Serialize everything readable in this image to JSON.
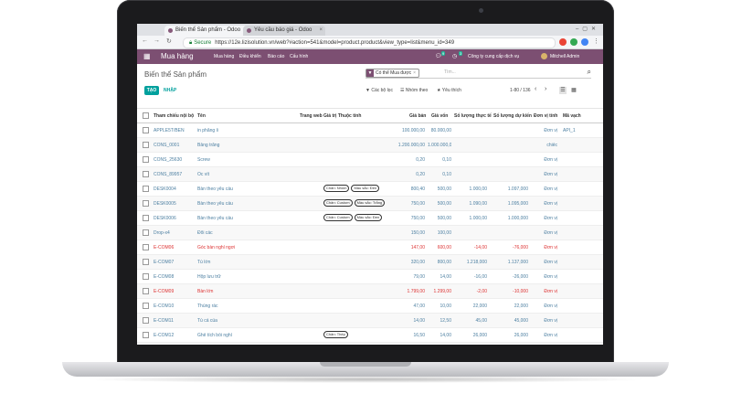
{
  "browser": {
    "tabs": [
      {
        "title": "Biến thể Sản phẩm - Odoo"
      },
      {
        "title": "Yêu cầu báo giá - Odoo"
      }
    ],
    "secure_label": "Secure",
    "url": "https://12e.lizisolution.vn/web?#action=541&model=product.product&view_type=list&menu_id=349"
  },
  "odoo_nav": {
    "brand": "Mua hàng",
    "menus": [
      "Mua hàng",
      "Điều khiển",
      "Báo cáo",
      "Cấu hình"
    ],
    "company": "Công ty cung cấp dịch vụ",
    "user": "Mitchell Admin",
    "badges": [
      "9",
      "3"
    ]
  },
  "control_panel": {
    "breadcrumb": "Biến thể Sản phẩm",
    "facet_label": "Có thể Mua được",
    "search_placeholder": "Tìm...",
    "create_label": "TẠO",
    "import_label": "NHẬP",
    "filters_label": "Các bộ lọc",
    "groupby_label": "Nhóm theo",
    "favorites_label": "Yêu thích",
    "pager": "1-80 / 136"
  },
  "table": {
    "headers": [
      "Tham chiếu nội bộ",
      "Tên",
      "Trang web",
      "Giá trị Thuộc tính",
      "Giá bán",
      "Giá vốn",
      "Số lượng thực tế",
      "Số lượng dự kiến",
      "Đơn vị tính",
      "Mã vạch"
    ],
    "rows": [
      {
        "ref": "APPLE5T/BEN",
        "name": "in phẳng ỉi",
        "attrs": [],
        "price": "100.000,00",
        "cost": "80.000,00",
        "qty": "",
        "forecast": "",
        "uom": "Đơn vị",
        "barcode": "API_1",
        "red": false
      },
      {
        "ref": "CONS_0001",
        "name": "Bảng trắng",
        "attrs": [],
        "price": "1.200.000,00",
        "cost": "1.000.000,00",
        "qty": "",
        "forecast": "",
        "uom": "chiếc",
        "barcode": "",
        "red": false
      },
      {
        "ref": "CONS_25630",
        "name": "Screw",
        "attrs": [],
        "price": "0,20",
        "cost": "0,10",
        "qty": "",
        "forecast": "",
        "uom": "Đơn vị",
        "barcode": "",
        "red": false
      },
      {
        "ref": "CONS_89957",
        "name": "Ốc vít",
        "attrs": [],
        "price": "0,20",
        "cost": "0,10",
        "qty": "",
        "forecast": "",
        "uom": "Đơn vị",
        "barcode": "",
        "red": false
      },
      {
        "ref": "DESK0004",
        "name": "Bàn theo yêu cầu",
        "attrs": [
          "Chân: Nhôm",
          "Màu sắc: Đen"
        ],
        "price": "800,40",
        "cost": "500,00",
        "qty": "1.000,00",
        "forecast": "1.097,000",
        "uom": "Đơn vị",
        "barcode": "",
        "red": false
      },
      {
        "ref": "DESK0005",
        "name": "Bàn theo yêu cầu",
        "attrs": [
          "Chân: Custom",
          "Màu sắc: Trắng"
        ],
        "price": "750,00",
        "cost": "500,00",
        "qty": "1.090,00",
        "forecast": "1.095,000",
        "uom": "Đơn vị",
        "barcode": "",
        "red": false
      },
      {
        "ref": "DESK0006",
        "name": "Bàn theo yêu cầu",
        "attrs": [
          "Chân: Custom",
          "Màu sắc: Đen"
        ],
        "price": "750,00",
        "cost": "500,00",
        "qty": "1.000,00",
        "forecast": "1.000,000",
        "uom": "Đơn vị",
        "barcode": "",
        "red": false
      },
      {
        "ref": "Drop-x4",
        "name": "Đổi các",
        "attrs": [],
        "price": "150,00",
        "cost": "100,00",
        "qty": "",
        "forecast": "",
        "uom": "Đơn vị",
        "barcode": "",
        "red": false
      },
      {
        "ref": "E-COM06",
        "name": "Góc bàn nghỉ ngơi",
        "attrs": [],
        "price": "147,00",
        "cost": "600,00",
        "qty": "-14,00",
        "forecast": "-76,000",
        "uom": "Đơn vị",
        "barcode": "",
        "red": true
      },
      {
        "ref": "E-COM07",
        "name": "Tủ lớn",
        "attrs": [],
        "price": "320,00",
        "cost": "800,00",
        "qty": "1.218,000",
        "forecast": "1.137,000",
        "uom": "Đơn vị",
        "barcode": "",
        "red": false
      },
      {
        "ref": "E-COM08",
        "name": "Hộp lưu trữ",
        "attrs": [],
        "price": "79,00",
        "cost": "14,00",
        "qty": "-16,00",
        "forecast": "-26,000",
        "uom": "Đơn vị",
        "barcode": "",
        "red": false
      },
      {
        "ref": "E-COM09",
        "name": "Bàn lớn",
        "attrs": [],
        "price": "1.799,00",
        "cost": "1.299,00",
        "qty": "-2,00",
        "forecast": "-10,000",
        "uom": "Đơn vị",
        "barcode": "",
        "red": true
      },
      {
        "ref": "E-COM10",
        "name": "Thùng rác",
        "attrs": [],
        "price": "47,00",
        "cost": "10,00",
        "qty": "22,000",
        "forecast": "22,000",
        "uom": "Đơn vị",
        "barcode": "",
        "red": false
      },
      {
        "ref": "E-COM11",
        "name": "Tủ cá của",
        "attrs": [],
        "price": "14,00",
        "cost": "12,50",
        "qty": "45,00",
        "forecast": "45,000",
        "uom": "Đơn vị",
        "barcode": "",
        "red": false
      },
      {
        "ref": "E-COM12",
        "name": "Ghế tích bồi nghỉ",
        "attrs": [
          "Chân: Thép"
        ],
        "price": "16,50",
        "cost": "14,00",
        "qty": "26,000",
        "forecast": "26,000",
        "uom": "Đơn vị",
        "barcode": "",
        "red": false
      },
      {
        "ref": "E-COM13",
        "name": "Ghế tích bồi nghỉ",
        "attrs": [
          "Chân: Nhôm"
        ],
        "price": "22,00",
        "cost": "9,00",
        "qty": "50,000",
        "forecast": "50,000",
        "uom": "Đơn vị",
        "barcode": "",
        "red": false
      },
      {
        "ref": "EVENT_REG",
        "name": "Đăng ký Sự kiện",
        "attrs": [],
        "price": "",
        "cost": "",
        "qty": "",
        "forecast": "",
        "uom": "Đơn vị",
        "barcode": "",
        "red": false
      }
    ]
  },
  "colors": {
    "brand": "#7c4f72",
    "teal": "#00a09d",
    "link": "#4c7fa1",
    "negative": "#dd3333"
  }
}
